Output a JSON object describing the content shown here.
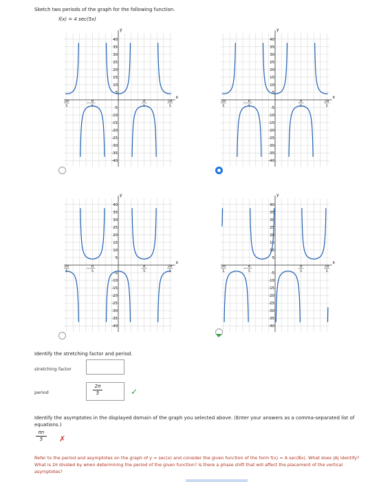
{
  "prompt": "Sketch two periods of the graph for the following function.",
  "function": "f(x) = 4 sec(5x)",
  "graph_labels": {
    "y": "y",
    "x": "x",
    "y_ticks": [
      "40",
      "35",
      "30",
      "25",
      "20",
      "15",
      "10",
      "5",
      "-5",
      "-10",
      "-15",
      "-20",
      "-25",
      "-30",
      "-35",
      "-40"
    ],
    "x_ticks": [
      {
        "num": "2π",
        "den": "5",
        "neg": true
      },
      {
        "num": "π",
        "den": "5",
        "neg": true
      },
      {
        "num": "π",
        "den": "5",
        "neg": false
      },
      {
        "num": "2π",
        "den": "5",
        "neg": false
      }
    ]
  },
  "options": [
    {
      "id": "A",
      "selected": false,
      "variant": "A"
    },
    {
      "id": "B",
      "selected": true,
      "variant": "B"
    },
    {
      "id": "C",
      "selected": false,
      "variant": "C"
    },
    {
      "id": "D",
      "selected": false,
      "variant": "D"
    }
  ],
  "section1": {
    "title": "Identify the stretching factor and period.",
    "stretching_label": "stretching factor",
    "stretching_value": "",
    "period_label": "period",
    "period_num": "2π",
    "period_den": "5",
    "period_status": "✓"
  },
  "section2": {
    "title": "Identify the asymptotes in the displayed domain of the graph you selected above. (Enter your answers as a comma-separated list of equations.)",
    "answer_num": "πn",
    "answer_den": "5",
    "answer_status": "✗"
  },
  "hint": "Refer to the period and asymptotes on the graph of y = sec(x) and consider the given function of the form f(x) = A sec(Bx). What does |A| identify? What is 2π divided by when determining the period of the given function? Is there a phase shift that will affect the placement of the vertical asymptotes?",
  "colors": {
    "curve": "#1e5fb0",
    "grid": "#d7d7d7",
    "axis": "#333333",
    "selected": "#1a73e8",
    "correct": "#2e9e3c",
    "wrong": "#d3342a"
  }
}
